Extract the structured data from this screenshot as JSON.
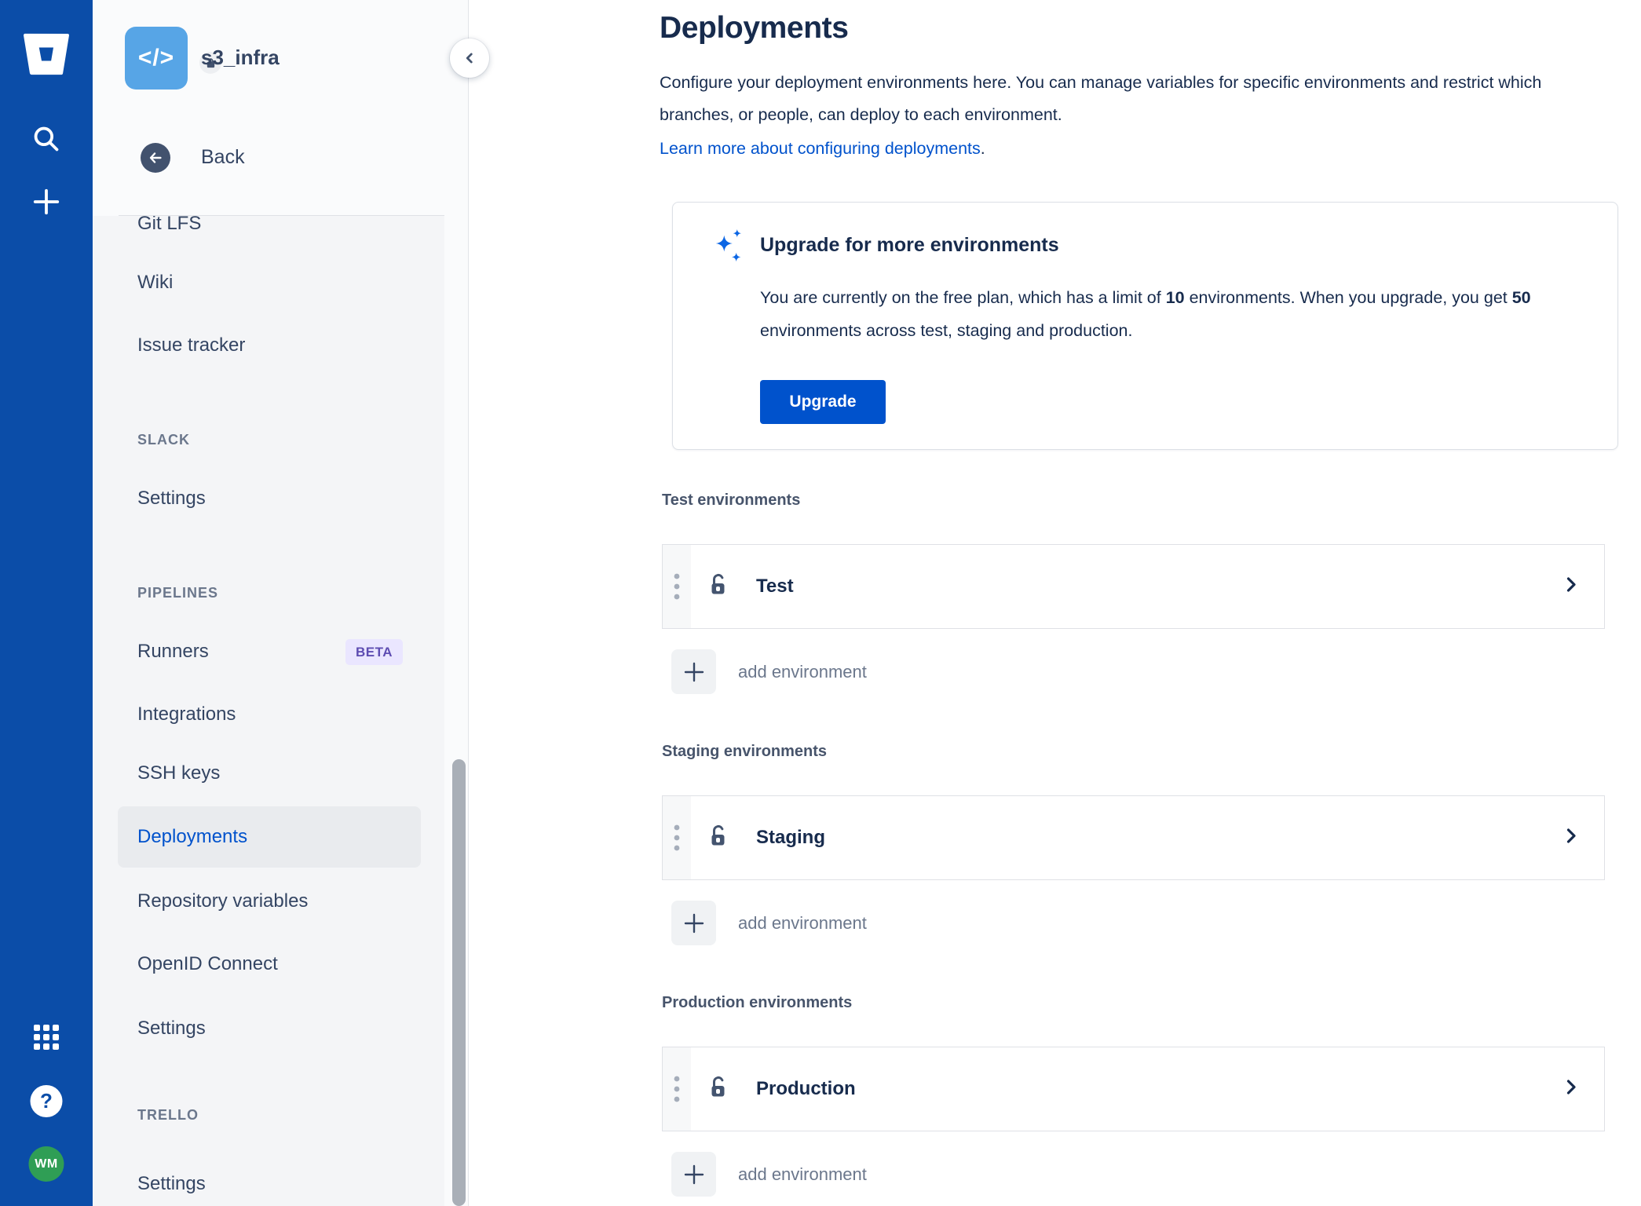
{
  "colors": {
    "rail_blue": "#0B4DA8",
    "link_blue": "#0052CC",
    "navy": "#172B4D",
    "sidebar_text": "#344563",
    "muted": "#6B778C",
    "repo_avatar_blue": "#57A5E6",
    "user_avatar_green": "#2F9E55",
    "beta_badge_bg": "#EAE6FF",
    "beta_badge_text": "#5E4DB2"
  },
  "rail": {
    "avatar_initials": "WM"
  },
  "sidebar": {
    "repo_name": "s3_infra",
    "repo_icon": "code-avatar",
    "back_label": "Back",
    "items": [
      {
        "label": "Git LFS",
        "type": "item"
      },
      {
        "label": "Wiki",
        "type": "item"
      },
      {
        "label": "Issue tracker",
        "type": "item"
      },
      {
        "label": "SLACK",
        "type": "header"
      },
      {
        "label": "Settings",
        "type": "item"
      },
      {
        "label": "PIPELINES",
        "type": "header"
      },
      {
        "label": "Runners",
        "type": "item",
        "badge": "BETA"
      },
      {
        "label": "Integrations",
        "type": "item"
      },
      {
        "label": "SSH keys",
        "type": "item"
      },
      {
        "label": "Deployments",
        "type": "item",
        "selected": true
      },
      {
        "label": "Repository variables",
        "type": "item"
      },
      {
        "label": "OpenID Connect",
        "type": "item"
      },
      {
        "label": "Settings",
        "type": "item"
      },
      {
        "label": "TRELLO",
        "type": "header"
      },
      {
        "label": "Settings",
        "type": "item"
      }
    ]
  },
  "main": {
    "title": "Deployments",
    "description": "Configure your deployment environments here. You can manage variables for specific environments and restrict which branches, or people, can deploy to each environment.",
    "learn_more_label": "Learn more about configuring deployments",
    "learn_more_suffix": ".",
    "upgrade_card": {
      "title": "Upgrade for more environments",
      "body_runs": [
        {
          "text": "You are currently on the free plan, which has a limit of ",
          "bold": false
        },
        {
          "text": "10",
          "bold": true
        },
        {
          "text": " environments. When you upgrade, you get ",
          "bold": false
        },
        {
          "text": "50",
          "bold": true
        },
        {
          "text": " environments across test, staging and production.",
          "bold": false
        }
      ],
      "button_label": "Upgrade"
    },
    "sections": [
      {
        "label": "Test environments",
        "environment": "Test",
        "add_label": "add environment"
      },
      {
        "label": "Staging environments",
        "environment": "Staging",
        "add_label": "add environment"
      },
      {
        "label": "Production environments",
        "environment": "Production",
        "add_label": "add environment"
      }
    ]
  }
}
